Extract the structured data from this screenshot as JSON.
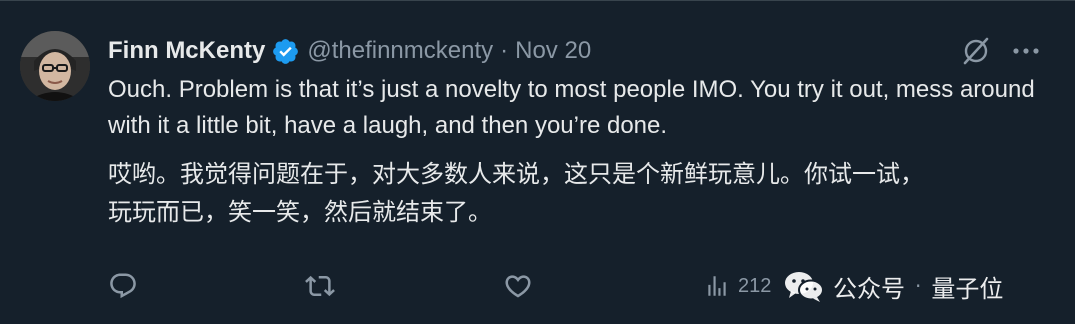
{
  "tweet": {
    "author_name": "Finn McKenty",
    "handle": "@thefinnmckenty",
    "separator": "·",
    "date": "Nov 20",
    "text_en": "Ouch. Problem is that it’s just a novelty to most people IMO. You try it out, mess around with it a little bit, have a laugh, and then you’re done.",
    "text_zh_line1": "哎哟。我觉得问题在于，对大多数人来说，这只是个新鲜玩意儿。你试一试，",
    "text_zh_line2": "玩玩而已，笑一笑，然后就结束了。"
  },
  "actions": {
    "reply_icon": "reply-icon",
    "retweet_icon": "retweet-icon",
    "like_icon": "like-icon",
    "views_icon": "views-icon",
    "views_count": "212"
  },
  "watermark": {
    "account_label": "公众号",
    "separator": "·",
    "brand": "量子位"
  },
  "colors": {
    "background": "#15202b",
    "text_primary": "#e7e9ea",
    "text_secondary": "#8b98a5",
    "verified_badge": "#1d9bf0"
  }
}
